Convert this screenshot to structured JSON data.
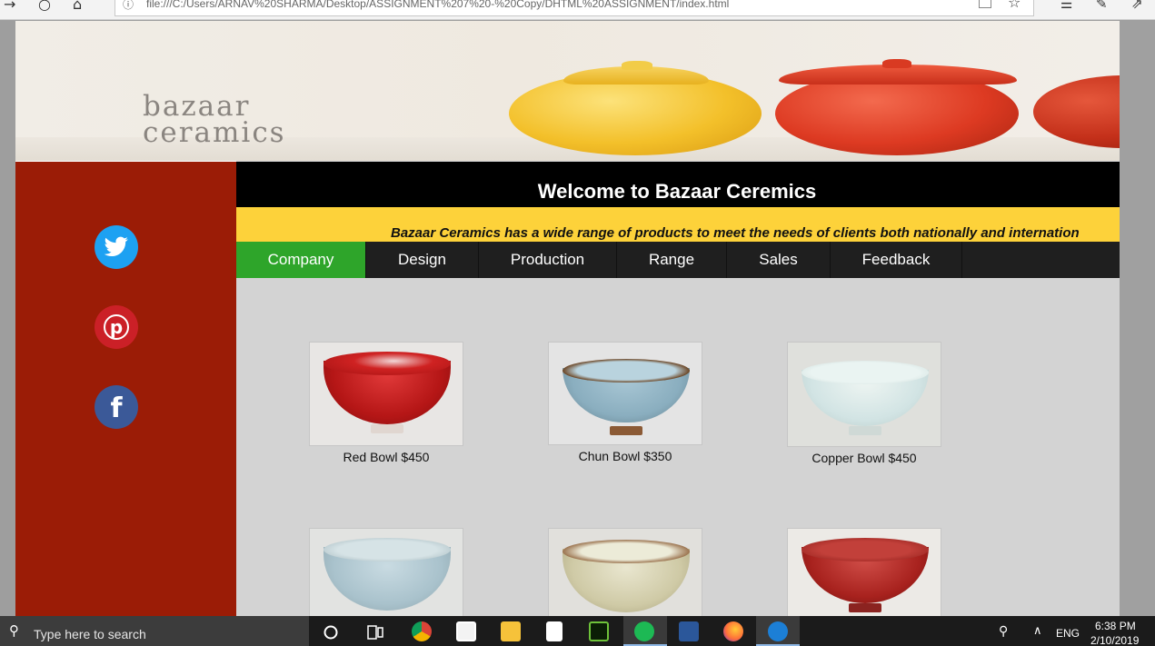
{
  "browser": {
    "url": "file:///C:/Users/ARNAV%20SHARMA/Desktop/ASSIGNMENT%207%20-%20Copy/DHTML%20ASSIGNMENT/index.html"
  },
  "banner": {
    "brand_line1": "bazaar",
    "brand_line2": "ceramics"
  },
  "header": {
    "welcome": "Welcome to Bazaar Ceremics",
    "marquee": "Bazaar Ceramics has a wide range of products to meet the needs of clients both nationally and internation"
  },
  "nav": {
    "items": [
      "Company",
      "Design",
      "Production",
      "Range",
      "Sales",
      "Feedback"
    ],
    "active": "Company"
  },
  "products": [
    {
      "caption": "Red Bowl $450"
    },
    {
      "caption": "Chun Bowl $350"
    },
    {
      "caption": "Copper Bowl $450"
    },
    {
      "caption": ""
    },
    {
      "caption": ""
    },
    {
      "caption": ""
    }
  ],
  "social": [
    "twitter-icon",
    "pinterest-icon",
    "facebook-icon"
  ],
  "taskbar": {
    "search_placeholder": "Type here to search",
    "lang": "ENG",
    "time": "6:38 PM",
    "date": "2/10/2019"
  },
  "colors": {
    "sidebar": "#9b1c06",
    "header": "#000000",
    "marquee_bg": "#fdd23a",
    "nav_bg": "#1f1f1f",
    "nav_active": "#2ea52a",
    "content_bg": "#d3d3d3"
  }
}
